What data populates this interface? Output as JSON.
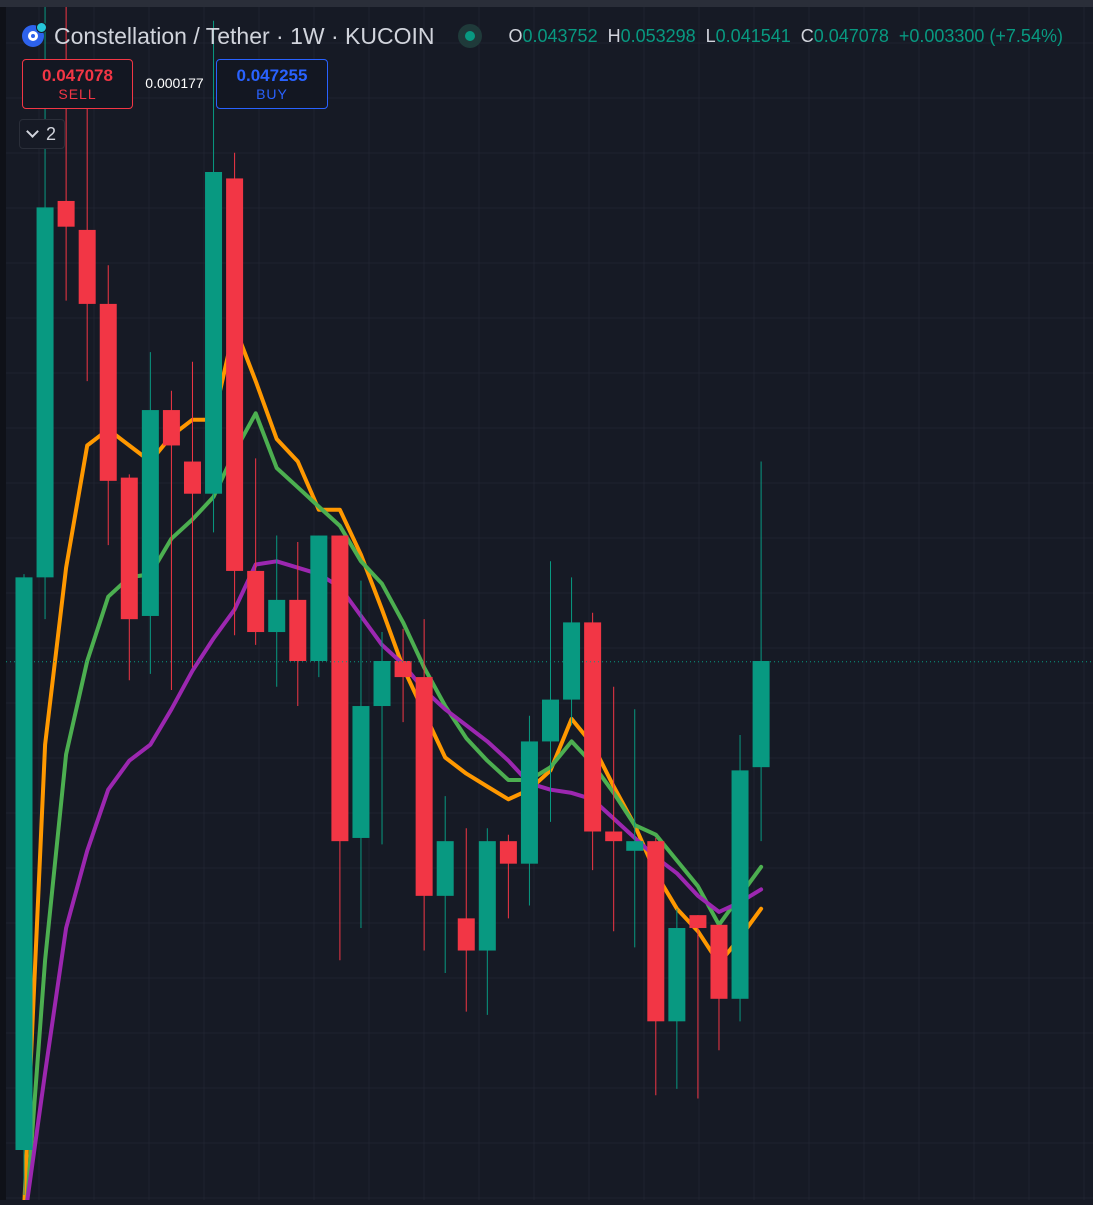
{
  "header": {
    "symbol_title": "Constellation / Tether · 1W · KUCOIN",
    "ohlc": {
      "open_key": "O",
      "open": "0.043752",
      "high_key": "H",
      "high": "0.053298",
      "low_key": "L",
      "low": "0.041541",
      "close_key": "C",
      "close": "0.047078",
      "change": "+0.003300 (+7.54%)"
    },
    "icons": [
      "constellation-logo-icon",
      "market-status-icon"
    ]
  },
  "trade_panel": {
    "sell_price": "0.047078",
    "sell_label": "SELL",
    "spread": "0.000177",
    "buy_price": "0.047255",
    "buy_label": "BUY"
  },
  "indicators_toggle": {
    "count": "2",
    "icon": "chevron-down-icon"
  },
  "colors": {
    "background": "#161a25",
    "up": "#089981",
    "down": "#f23645",
    "grid": "#1f2330",
    "ma_orange": "#ff9800",
    "ma_green": "#4caf50",
    "ma_purple": "#9c27b0"
  },
  "chart_data": {
    "type": "candlestick",
    "title": "Constellation / Tether · 1W · KUCOIN",
    "xlabel": "",
    "ylabel": "",
    "y_range_visible": [
      0.0306,
      0.0674
    ],
    "grid": true,
    "current_price": 0.047078,
    "candles": [
      {
        "o": 0.0319,
        "h": 0.0498,
        "l": 0.0305,
        "c": 0.0497
      },
      {
        "o": 0.0497,
        "h": 0.0699,
        "l": 0.0484,
        "c": 0.0612
      },
      {
        "o": 0.0614,
        "h": 0.0688,
        "l": 0.0583,
        "c": 0.0606
      },
      {
        "o": 0.0605,
        "h": 0.0655,
        "l": 0.0558,
        "c": 0.0582
      },
      {
        "o": 0.0582,
        "h": 0.0594,
        "l": 0.0507,
        "c": 0.0527
      },
      {
        "o": 0.0528,
        "h": 0.0529,
        "l": 0.0465,
        "c": 0.0484
      },
      {
        "o": 0.0485,
        "h": 0.0567,
        "l": 0.0467,
        "c": 0.0549
      },
      {
        "o": 0.0549,
        "h": 0.0555,
        "l": 0.0462,
        "c": 0.0538
      },
      {
        "o": 0.0533,
        "h": 0.0564,
        "l": 0.0469,
        "c": 0.0523
      },
      {
        "o": 0.0523,
        "h": 0.067,
        "l": 0.0511,
        "c": 0.0623
      },
      {
        "o": 0.0621,
        "h": 0.0629,
        "l": 0.0479,
        "c": 0.0499
      },
      {
        "o": 0.0499,
        "h": 0.0534,
        "l": 0.0476,
        "c": 0.048
      },
      {
        "o": 0.048,
        "h": 0.051,
        "l": 0.0463,
        "c": 0.049
      },
      {
        "o": 0.049,
        "h": 0.0508,
        "l": 0.0457,
        "c": 0.0471
      },
      {
        "o": 0.0471,
        "h": 0.051,
        "l": 0.0466,
        "c": 0.051
      },
      {
        "o": 0.051,
        "h": 0.051,
        "l": 0.0378,
        "c": 0.0415
      },
      {
        "o": 0.0416,
        "h": 0.0496,
        "l": 0.0388,
        "c": 0.0457
      },
      {
        "o": 0.0457,
        "h": 0.048,
        "l": 0.0414,
        "c": 0.0471
      },
      {
        "o": 0.0471,
        "h": 0.0481,
        "l": 0.0452,
        "c": 0.0466
      },
      {
        "o": 0.0466,
        "h": 0.0484,
        "l": 0.0381,
        "c": 0.0398
      },
      {
        "o": 0.0398,
        "h": 0.0429,
        "l": 0.0374,
        "c": 0.0415
      },
      {
        "o": 0.0391,
        "h": 0.0419,
        "l": 0.0362,
        "c": 0.0381
      },
      {
        "o": 0.0381,
        "h": 0.0419,
        "l": 0.0361,
        "c": 0.0415
      },
      {
        "o": 0.0415,
        "h": 0.0417,
        "l": 0.0391,
        "c": 0.0408
      },
      {
        "o": 0.0408,
        "h": 0.0454,
        "l": 0.0395,
        "c": 0.0446
      },
      {
        "o": 0.0446,
        "h": 0.0502,
        "l": 0.0421,
        "c": 0.0459
      },
      {
        "o": 0.0459,
        "h": 0.0497,
        "l": 0.0451,
        "c": 0.0483
      },
      {
        "o": 0.0483,
        "h": 0.0486,
        "l": 0.0406,
        "c": 0.0418
      },
      {
        "o": 0.0418,
        "h": 0.0463,
        "l": 0.0387,
        "c": 0.0415
      },
      {
        "o": 0.0412,
        "h": 0.0456,
        "l": 0.0382,
        "c": 0.0415
      },
      {
        "o": 0.0415,
        "h": 0.0416,
        "l": 0.0336,
        "c": 0.0359
      },
      {
        "o": 0.0359,
        "h": 0.0394,
        "l": 0.0338,
        "c": 0.0388
      },
      {
        "o": 0.0392,
        "h": 0.0392,
        "l": 0.0335,
        "c": 0.0388
      },
      {
        "o": 0.0389,
        "h": 0.0389,
        "l": 0.035,
        "c": 0.0366
      },
      {
        "o": 0.0366,
        "h": 0.0448,
        "l": 0.0359,
        "c": 0.0437
      },
      {
        "o": 0.0438,
        "h": 0.0533,
        "l": 0.0415,
        "c": 0.0471
      }
    ],
    "series": [
      {
        "color": "#ff9800",
        "values": [
          0.03,
          0.0445,
          0.05,
          0.0538,
          0.0543,
          0.0538,
          0.0533,
          0.0541,
          0.0546,
          0.0546,
          0.0575,
          0.0558,
          0.054,
          0.0533,
          0.0518,
          0.0518,
          0.0504,
          0.0487,
          0.0469,
          0.0455,
          0.0441,
          0.0436,
          0.0432,
          0.0428,
          0.0431,
          0.0437,
          0.0453,
          0.0445,
          0.0432,
          0.042,
          0.0405,
          0.0394,
          0.0387,
          0.0377,
          0.0385,
          0.0394
        ]
      },
      {
        "color": "#4caf50",
        "values": [
          0.029,
          0.0378,
          0.0442,
          0.0471,
          0.0491,
          0.0497,
          0.0498,
          0.0509,
          0.0515,
          0.0522,
          0.0536,
          0.0548,
          0.0531,
          0.0525,
          0.0519,
          0.0513,
          0.0502,
          0.0495,
          0.0483,
          0.0469,
          0.0457,
          0.0447,
          0.044,
          0.0434,
          0.0434,
          0.0438,
          0.0446,
          0.0439,
          0.043,
          0.042,
          0.0417,
          0.0409,
          0.0401,
          0.0389,
          0.0398,
          0.0407
        ]
      },
      {
        "color": "#9c27b0",
        "values": [
          0.0296,
          0.0343,
          0.0388,
          0.0412,
          0.0431,
          0.044,
          0.0445,
          0.0456,
          0.0468,
          0.0478,
          0.0487,
          0.0501,
          0.0502,
          0.05,
          0.0498,
          0.0494,
          0.0485,
          0.0476,
          0.047,
          0.0462,
          0.0456,
          0.0451,
          0.0446,
          0.044,
          0.0433,
          0.0431,
          0.043,
          0.0428,
          0.0422,
          0.0416,
          0.041,
          0.0405,
          0.0398,
          0.0393,
          0.0396,
          0.04
        ]
      }
    ]
  }
}
